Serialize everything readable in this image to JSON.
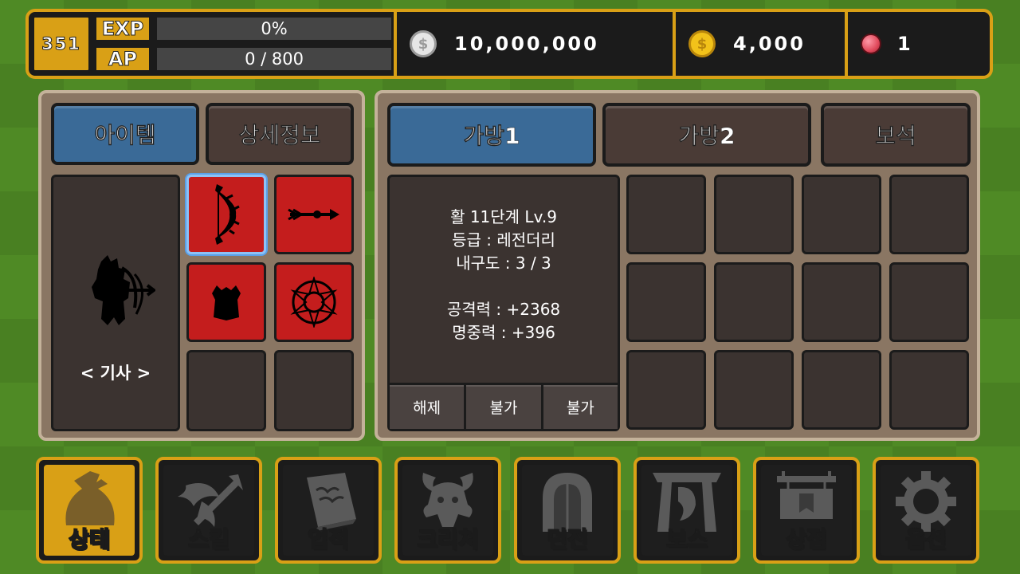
{
  "header": {
    "level": "351",
    "exp_label": "EXP",
    "exp_value": "0%",
    "ap_label": "AP",
    "ap_value": "0 / 800",
    "silver": "10,000,000",
    "gold": "4,000",
    "gem": "1",
    "silver_icon": "silver-coin-icon",
    "gold_icon": "gold-coin-icon",
    "gem_icon": "red-gem-icon"
  },
  "left_panel": {
    "tabs": [
      "아이템",
      "상세정보"
    ],
    "active_tab": "아이템",
    "character_label": "< 기사 >",
    "equip_slots": [
      {
        "icon": "bow-icon",
        "filled": true,
        "selected": true
      },
      {
        "icon": "arrow-icon",
        "filled": true,
        "selected": false
      },
      {
        "icon": "armor-icon",
        "filled": true,
        "selected": false
      },
      {
        "icon": "pentagram-icon",
        "filled": true,
        "selected": false
      },
      {
        "icon": "",
        "filled": false,
        "selected": false
      },
      {
        "icon": "",
        "filled": false,
        "selected": false
      }
    ]
  },
  "right_panel": {
    "tabs": [
      "가방1",
      "가방2",
      "보석"
    ],
    "active_tab": "가방1",
    "item_info": {
      "name": "활 11단계 Lv.9",
      "grade": "등급 : 레전더리",
      "durability": "내구도 : 3 / 3",
      "attack": "공격력 : +2368",
      "accuracy": "명중력 : +396"
    },
    "actions": [
      "해제",
      "불가",
      "불가"
    ],
    "bag_slot_count": 12
  },
  "nav": [
    {
      "label": "상태",
      "icon": "pouch-icon",
      "active": true
    },
    {
      "label": "스킬",
      "icon": "skill-icon",
      "active": false
    },
    {
      "label": "업적",
      "icon": "book-icon",
      "active": false
    },
    {
      "label": "크리쳐",
      "icon": "creature-icon",
      "active": false
    },
    {
      "label": "던전",
      "icon": "dungeon-door-icon",
      "active": false
    },
    {
      "label": "보스",
      "icon": "boss-gate-icon",
      "active": false
    },
    {
      "label": "상점",
      "icon": "shop-sign-icon",
      "active": false
    },
    {
      "label": "옵션",
      "icon": "gear-icon",
      "active": false
    }
  ],
  "colors": {
    "gold_border": "#d9a016",
    "active_tab": "#3a6a97",
    "inactive_tab": "#4a3b36",
    "item_slot_red": "#c41d1d",
    "panel_bg": "#8a7663",
    "grass": "#4f8a25"
  }
}
